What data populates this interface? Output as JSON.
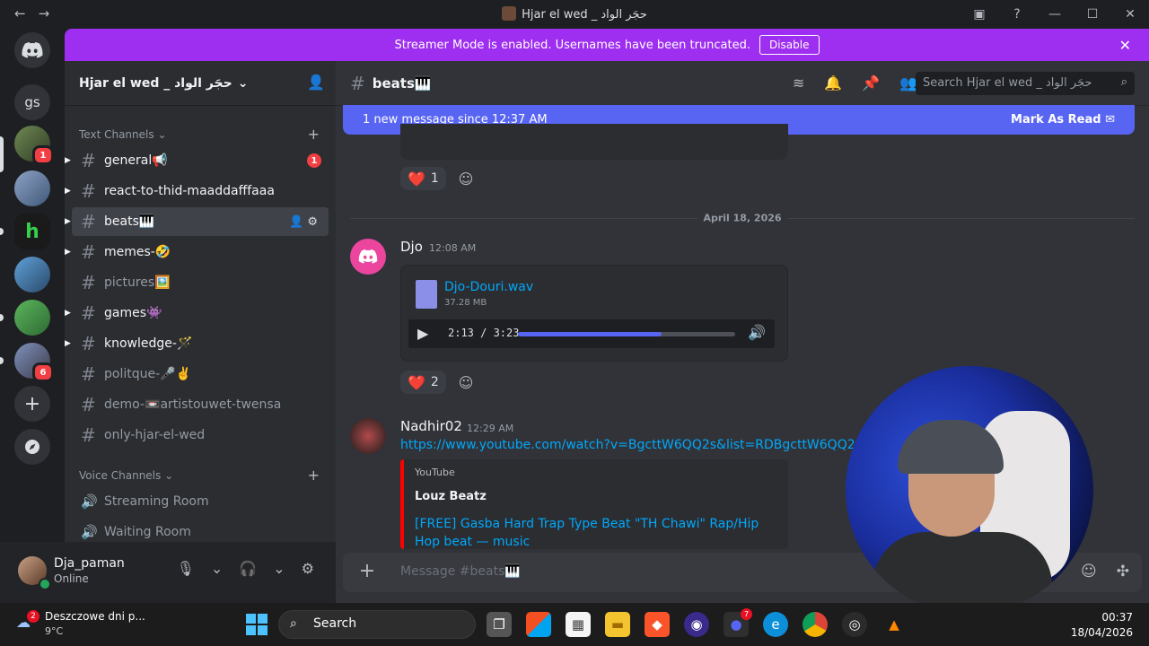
{
  "window": {
    "title": "Hjar el wed _ حجَر الواد",
    "nav": [
      "←",
      "→"
    ],
    "controls": [
      "▣",
      "?",
      "—",
      "☐",
      "✕"
    ]
  },
  "rail": {
    "home_icon": "discord-logo-icon",
    "gs_label": "gs",
    "badges": [
      "1",
      "6"
    ],
    "add_label": "+",
    "discover_icon": "compass-icon"
  },
  "banner": {
    "text": "Streamer Mode is enabled. Usernames have been truncated.",
    "button": "Disable",
    "close": "✕"
  },
  "server": {
    "name": "Hjar el wed _ حجَر الواد",
    "chevron": "⌄"
  },
  "categories": {
    "text": "Text Channels",
    "voice": "Voice Channels"
  },
  "text_channels": [
    {
      "name": "general📢",
      "badge": "1"
    },
    {
      "name": "react-to-thid-maaddafffaaa"
    },
    {
      "name": "beats🎹"
    },
    {
      "name": "memes-🤣"
    },
    {
      "name": "pictures🖼️"
    },
    {
      "name": "games👾"
    },
    {
      "name": "knowledge-🪄"
    },
    {
      "name": "politque-🎤✌️"
    },
    {
      "name": "demo-📼artistouwet-twensa"
    },
    {
      "name": "only-hjar-el-wed"
    }
  ],
  "voice_channels": [
    {
      "name": "Streaming Room"
    },
    {
      "name": "Waiting Room"
    }
  ],
  "user": {
    "name": "Dja_paman",
    "status": "Online"
  },
  "channel_header": {
    "name": "beats🎹",
    "search_placeholder": "Search Hjar el wed _ حجَر الواد"
  },
  "new_messages": {
    "text": "1 new message since 12:37 AM",
    "action": "Mark As Read"
  },
  "date_divider": "April 18, 2026",
  "reactions": [
    {
      "emoji": "❤️",
      "count": "1"
    },
    {
      "emoji": "❤️",
      "count": "2"
    }
  ],
  "messages": [
    {
      "author": "Djo",
      "time": "12:08 AM",
      "file_name": "Djo-Douri.wav",
      "file_size": "37.28 MB",
      "player_time": "2:13 / 3:23",
      "progress": 0.66
    },
    {
      "author": "Nadhir02",
      "time": "12:29 AM",
      "link": "https://www.youtube.com/watch?v=BgcttW6QQ2s&list=RDBgcttW6QQ2s&",
      "embed_provider": "YouTube",
      "embed_author": "Louz Beatz",
      "embed_title": "[FREE] Gasba Hard Trap Type Beat \"TH Chawi\" Rap/Hip Hop beat — music"
    }
  ],
  "composer": {
    "placeholder": "Message #beats🎹"
  },
  "taskbar": {
    "weather_badge": "2",
    "weather_text": "Deszczowe dni p...",
    "weather_temp": "9°C",
    "search_label": "Search",
    "discord_badge": "7",
    "time": "00:37",
    "date": "18/04/2026"
  }
}
